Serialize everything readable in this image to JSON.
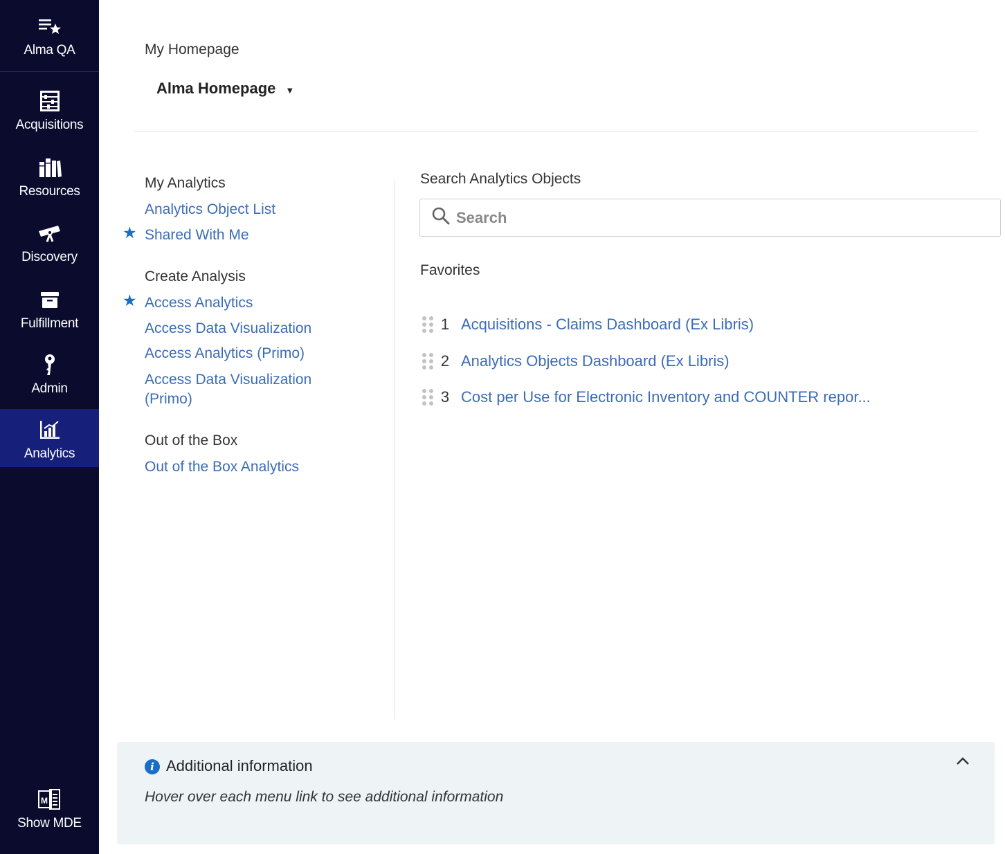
{
  "sidebar": {
    "items": [
      {
        "label": "Alma QA",
        "icon": "star-list-icon"
      },
      {
        "label": "Acquisitions",
        "icon": "abacus-icon"
      },
      {
        "label": "Resources",
        "icon": "books-icon"
      },
      {
        "label": "Discovery",
        "icon": "telescope-icon"
      },
      {
        "label": "Fulfillment",
        "icon": "archive-box-icon"
      },
      {
        "label": "Admin",
        "icon": "key-icon"
      },
      {
        "label": "Analytics",
        "icon": "bar-chart-icon",
        "active": true
      },
      {
        "label": "Show MDE",
        "icon": "mde-icon"
      }
    ],
    "bg_color": "#0b0b2e",
    "active_color": "#16207a"
  },
  "header": {
    "title": "My Homepage",
    "homepage_select": "Alma Homepage",
    "caret": "▼"
  },
  "menu": {
    "my_analytics": {
      "title": "My Analytics",
      "links": [
        "Analytics Object List",
        "Shared With Me"
      ]
    },
    "create_analysis": {
      "title": "Create Analysis",
      "links": [
        "Access Analytics",
        "Access Data Visualization",
        "Access Analytics (Primo)",
        "Access Data Visualization (Primo)"
      ]
    },
    "out_of_box": {
      "title": "Out of the Box",
      "links": [
        "Out of the Box Analytics"
      ]
    },
    "link_color": "#3b6cb5",
    "star_color": "#1a6fc4"
  },
  "search": {
    "title": "Search Analytics Objects",
    "placeholder": "Search"
  },
  "favorites": {
    "title": "Favorites",
    "items": [
      {
        "num": "1",
        "label": "Acquisitions - Claims Dashboard (Ex Libris)"
      },
      {
        "num": "2",
        "label": "Analytics Objects Dashboard (Ex Libris)"
      },
      {
        "num": "3",
        "label": "Cost per Use for Electronic Inventory and COUNTER repor..."
      }
    ]
  },
  "info_panel": {
    "title": "Additional information",
    "text": "Hover over each menu link to see additional information",
    "bg_color": "#eef3f6"
  }
}
